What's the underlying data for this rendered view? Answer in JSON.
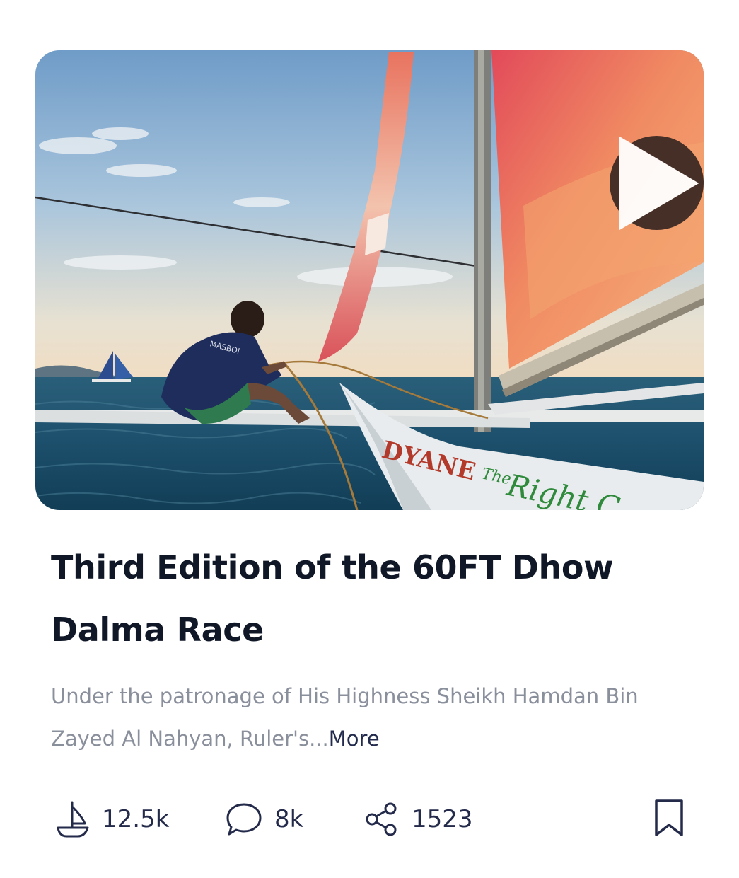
{
  "post": {
    "title": "Third Edition of the 60FT Dhow Dalma Race",
    "description": "Under the patronage of His Highness Sheikh Hamdan Bin Zayed Al Nahyan, Ruler's...",
    "more_label": "More",
    "media": {
      "type": "video",
      "play_icon": "play-icon",
      "boat_texts": [
        "MASBOI",
        "DYANE",
        "The Right C"
      ]
    }
  },
  "stats": {
    "sails": {
      "icon": "sailboat-icon",
      "count": "12.5k"
    },
    "comments": {
      "icon": "comment-icon",
      "count": "8k"
    },
    "shares": {
      "icon": "share-icon",
      "count": "1523"
    },
    "bookmark": {
      "icon": "bookmark-icon"
    }
  },
  "colors": {
    "title": "#101828",
    "description": "#8a8f9c",
    "more": "#232b4d",
    "stat_text": "#232a4a",
    "play_button": "#3d2a24"
  }
}
